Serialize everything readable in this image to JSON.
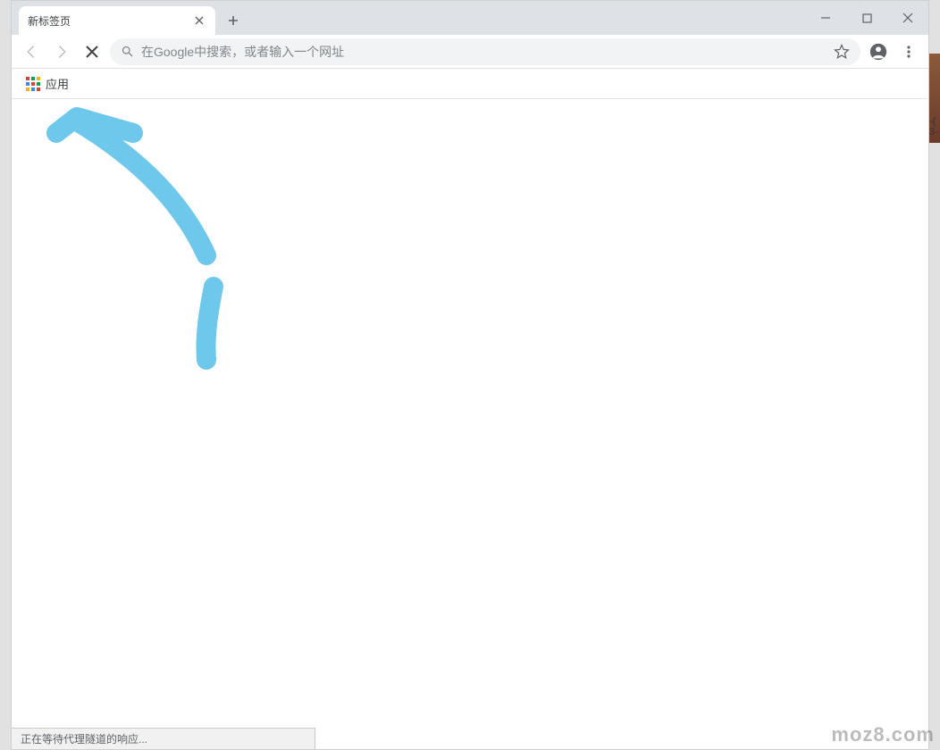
{
  "window": {
    "tab_title": "新标签页",
    "apps_label": "应用"
  },
  "toolbar": {
    "omnibox_placeholder": "在Google中搜索，或者输入一个网址"
  },
  "status": {
    "text": "正在等待代理隧道的响应..."
  },
  "annotation": {
    "color": "#6ec8ec"
  },
  "right_sliver": {
    "line1": "-(",
    "line2": "3-"
  },
  "watermark": "moz8.com"
}
